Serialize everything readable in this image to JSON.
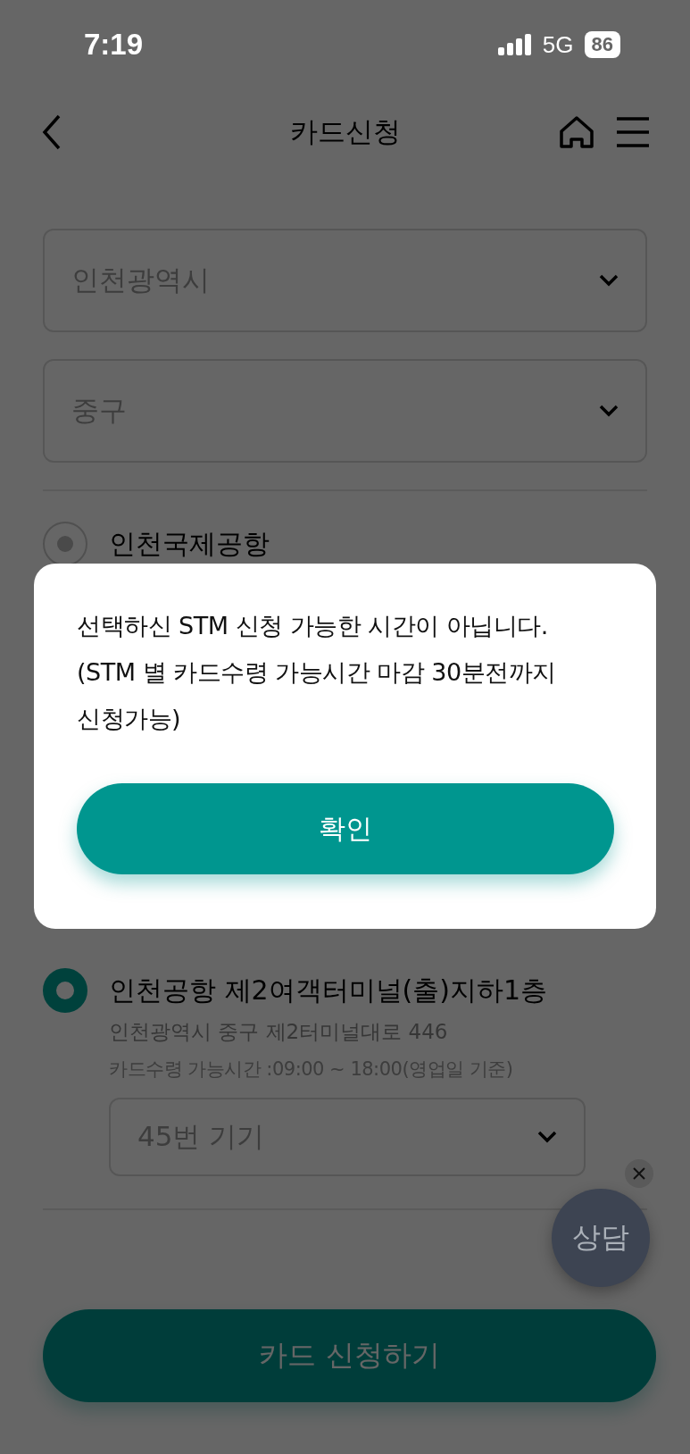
{
  "status_bar": {
    "time": "7:19",
    "network": "5G",
    "battery": "86"
  },
  "header": {
    "title": "카드신청"
  },
  "selects": [
    {
      "value": "인천광역시"
    },
    {
      "value": "중구"
    }
  ],
  "locations": [
    {
      "name": "인천국제공항",
      "selected": false
    },
    {
      "name": "인천공항 제2여객터미널(출)지하1층",
      "selected": true,
      "address": "인천광역시 중구 제2터미널대로 446",
      "hours": "카드수령 가능시간 :09:00 ~ 18:00(영업일 기준)",
      "device": "45번 기기"
    }
  ],
  "chat": {
    "label": "상담"
  },
  "submit": {
    "label": "카드 신청하기"
  },
  "dialog": {
    "message": "선택하신 STM 신청 가능한 시간이 아닙니다.\n(STM 별 카드수령 가능시간 마감 30분전까지\n신청가능)",
    "confirm": "확인"
  }
}
